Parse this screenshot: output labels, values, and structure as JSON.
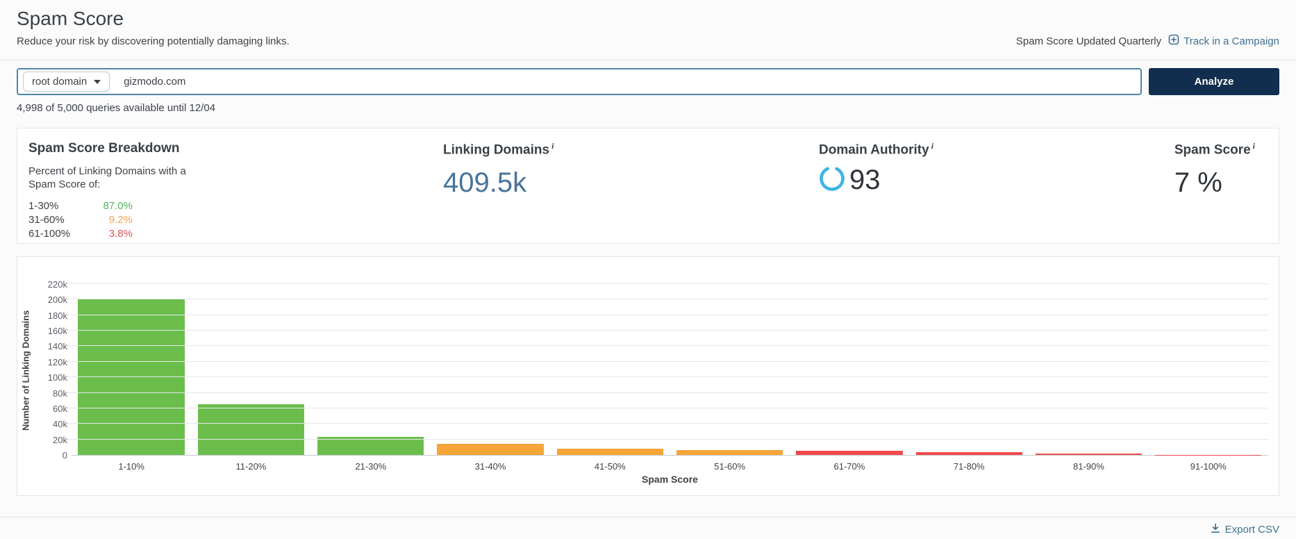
{
  "header": {
    "title": "Spam Score",
    "subtitle": "Reduce your risk by discovering potentially damaging links.",
    "updated_note": "Spam Score Updated Quarterly",
    "track_label": "Track in a Campaign"
  },
  "search": {
    "scope_label": "root domain",
    "query_value": "gizmodo.com",
    "analyze_label": "Analyze",
    "quota_note": "4,998 of 5,000 queries available until 12/04"
  },
  "summary": {
    "breakdown": {
      "title": "Spam Score Breakdown",
      "description": "Percent of Linking Domains with a Spam Score of:",
      "rows": [
        {
          "range": "1-30%",
          "value": "87.0%",
          "color": "#55b25a"
        },
        {
          "range": "31-60%",
          "value": "9.2%",
          "color": "#f0a24a"
        },
        {
          "range": "61-100%",
          "value": "3.8%",
          "color": "#e05557"
        }
      ]
    },
    "linking_domains": {
      "label": "Linking Domains",
      "info": "i",
      "value": "409.5k"
    },
    "domain_authority": {
      "label": "Domain Authority",
      "info": "i",
      "value": "93"
    },
    "spam_score": {
      "label": "Spam Score",
      "info": "i",
      "value": "7 %"
    }
  },
  "chart_data": {
    "type": "bar",
    "categories": [
      "1-10%",
      "11-20%",
      "21-30%",
      "31-40%",
      "41-50%",
      "51-60%",
      "61-70%",
      "71-80%",
      "81-90%",
      "91-100%"
    ],
    "values": [
      201000,
      65500,
      23000,
      14000,
      8000,
      6500,
      5800,
      3700,
      2100,
      200
    ],
    "bar_colors": [
      "#6cbe4c",
      "#6cbe4c",
      "#6cbe4c",
      "#f6a538",
      "#f6a538",
      "#f6a538",
      "#f0494c",
      "#f0494c",
      "#f0494c",
      "#f0494c"
    ],
    "xlabel": "Spam Score",
    "ylabel": "Number of Linking Domains",
    "ylim": [
      0,
      220000
    ],
    "grid": true,
    "legend": false,
    "yticks": [
      {
        "v": 0,
        "label": "0"
      },
      {
        "v": 20000,
        "label": "20k"
      },
      {
        "v": 40000,
        "label": "40k"
      },
      {
        "v": 60000,
        "label": "60k"
      },
      {
        "v": 80000,
        "label": "80k"
      },
      {
        "v": 100000,
        "label": "100k"
      },
      {
        "v": 120000,
        "label": "120k"
      },
      {
        "v": 140000,
        "label": "140k"
      },
      {
        "v": 160000,
        "label": "160k"
      },
      {
        "v": 180000,
        "label": "180k"
      },
      {
        "v": 200000,
        "label": "200k"
      },
      {
        "v": 220000,
        "label": "220k"
      }
    ]
  },
  "footer": {
    "export_label": "Export CSV"
  },
  "colors": {
    "accent_navy": "#112e4e",
    "link_blue": "#40708f",
    "search_border": "#4d87a8",
    "bar_green": "#6cbe4c",
    "bar_orange": "#f6a538",
    "bar_red": "#f0494c",
    "linking_domains_value": "#49749a",
    "domain_authority_ring": "#3cb4e7"
  }
}
